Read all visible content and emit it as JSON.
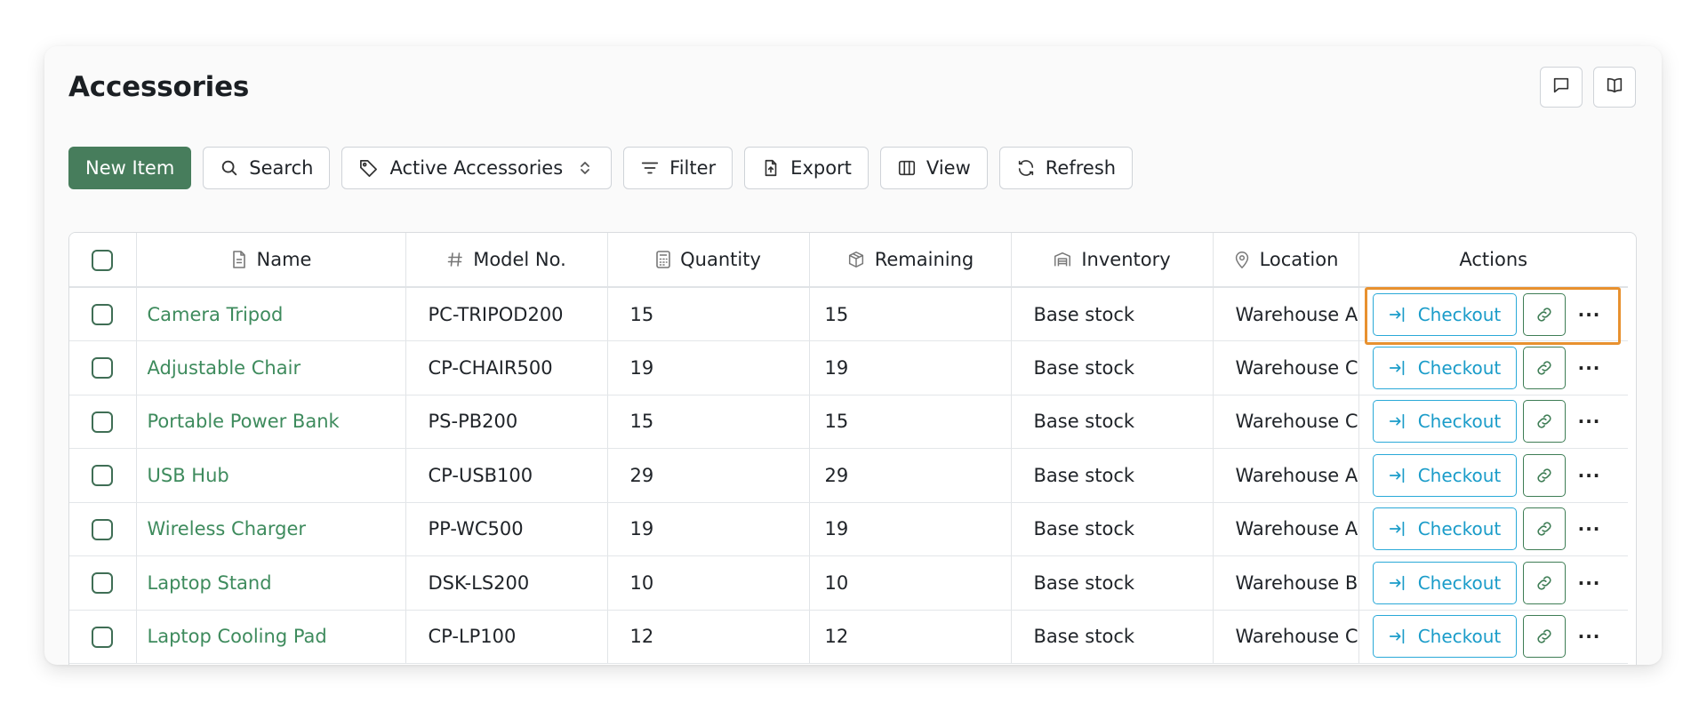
{
  "page": {
    "title": "Accessories",
    "top_icons": [
      "chat-icon",
      "book-icon"
    ]
  },
  "toolbar": {
    "new_item": "New Item",
    "search": "Search",
    "filter_select": "Active Accessories",
    "filter": "Filter",
    "export": "Export",
    "view": "View",
    "refresh": "Refresh"
  },
  "table": {
    "columns": [
      {
        "label": "Name",
        "icon": "document-icon"
      },
      {
        "label": "Model No.",
        "icon": "hash-icon"
      },
      {
        "label": "Quantity",
        "icon": "calculator-icon"
      },
      {
        "label": "Remaining",
        "icon": "box-icon"
      },
      {
        "label": "Inventory",
        "icon": "warehouse-icon"
      },
      {
        "label": "Location",
        "icon": "location-pin-icon"
      },
      {
        "label": "Actions",
        "icon": ""
      }
    ],
    "checkout_label": "Checkout",
    "rows": [
      {
        "name": "Camera Tripod",
        "model": "PC-TRIPOD200",
        "quantity": "15",
        "remaining": "15",
        "inventory": "Base stock",
        "location": "Warehouse A"
      },
      {
        "name": "Adjustable Chair",
        "model": "CP-CHAIR500",
        "quantity": "19",
        "remaining": "19",
        "inventory": "Base stock",
        "location": "Warehouse C"
      },
      {
        "name": "Portable Power Bank",
        "model": "PS-PB200",
        "quantity": "15",
        "remaining": "15",
        "inventory": "Base stock",
        "location": "Warehouse C"
      },
      {
        "name": "USB Hub",
        "model": "CP-USB100",
        "quantity": "29",
        "remaining": "29",
        "inventory": "Base stock",
        "location": "Warehouse A"
      },
      {
        "name": "Wireless Charger",
        "model": "PP-WC500",
        "quantity": "19",
        "remaining": "19",
        "inventory": "Base stock",
        "location": "Warehouse A"
      },
      {
        "name": "Laptop Stand",
        "model": "DSK-LS200",
        "quantity": "10",
        "remaining": "10",
        "inventory": "Base stock",
        "location": "Warehouse B"
      },
      {
        "name": "Laptop Cooling Pad",
        "model": "CP-LP100",
        "quantity": "12",
        "remaining": "12",
        "inventory": "Base stock",
        "location": "Warehouse C"
      }
    ]
  },
  "colors": {
    "primary_button": "#477d5c",
    "name_link": "#3e8b5d",
    "checkout_accent": "#1a9cc9",
    "highlight": "#e8912f"
  }
}
